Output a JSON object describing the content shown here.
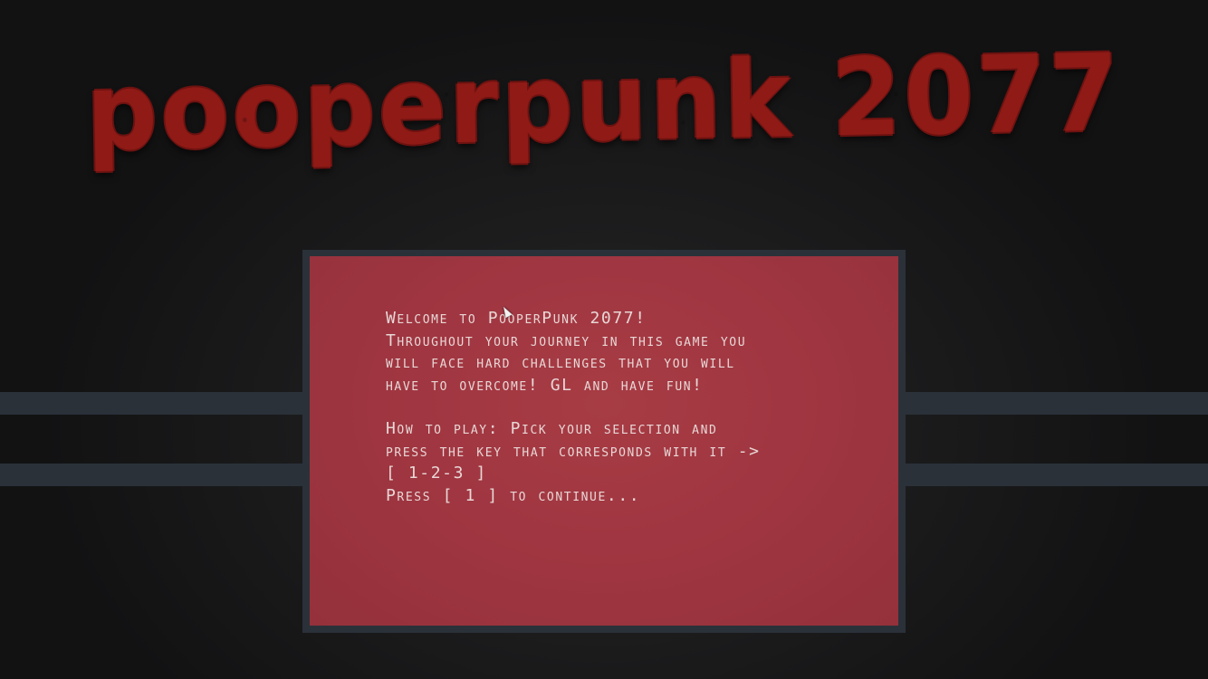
{
  "title": "PooperPunk 2077",
  "dialog": {
    "lines": [
      "Welcome to PooperPunk 2077!",
      "Throughout your journey in this game you",
      "will face hard challenges that you will",
      "have to overcome!   GL and have fun!",
      "How to play: Pick your selection and",
      "press the key that corresponds with it ->",
      "[ 1-2-3 ]",
      "Press [ 1 ] to continue..."
    ]
  },
  "colors": {
    "background": "#1d1d1e",
    "title": "#8f1a16",
    "panel": "#a03641",
    "frame": "#2b3139",
    "text": "#e8d7d6"
  },
  "icons": {
    "cursor": "mouse-pointer-icon"
  }
}
